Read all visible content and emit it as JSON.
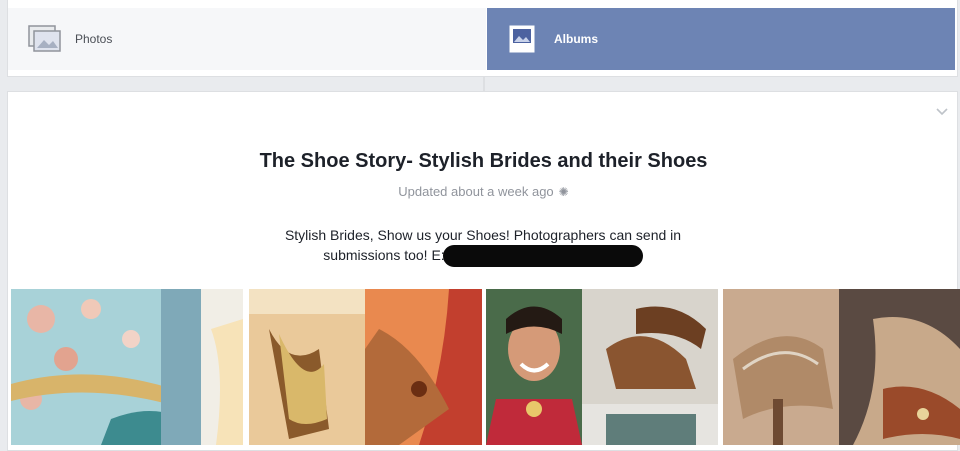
{
  "tabs": [
    {
      "label": "Photos",
      "icon": "photos-icon",
      "active": false
    },
    {
      "label": "Albums",
      "icon": "album-icon",
      "active": true
    }
  ],
  "album": {
    "title": "The Shoe Story- Stylish Brides and their Shoes",
    "updated": "Updated about a week ago",
    "description_line1": "Stylish Brides, Show us your Shoes! Photographers can send in",
    "description_line2": "submissions too! E:"
  },
  "colors": {
    "active_tab": "#6d84b4",
    "background": "#e9ebee"
  },
  "photos": [
    {
      "name": "photo-bride-floral-lehenga"
    },
    {
      "name": "photo-gold-heels-mehndi"
    },
    {
      "name": "photo-smiling-bride-shoes"
    },
    {
      "name": "photo-jeweled-heels"
    }
  ]
}
